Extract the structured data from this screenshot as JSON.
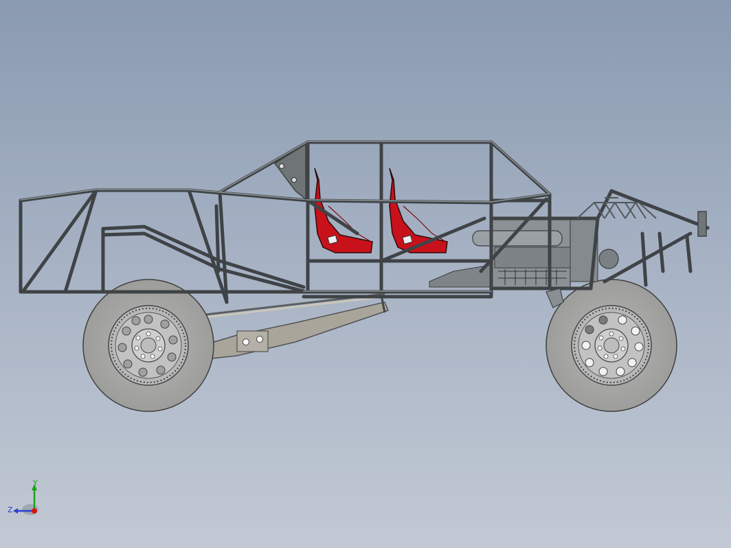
{
  "viewport": {
    "background_top": "#8a9ab0",
    "background_bottom": "#c2c9d4"
  },
  "model": {
    "frame_color": "#3f4346",
    "frame_fill": "#6d7275",
    "seat_color": "#c8111b",
    "tire_color": "#a9a9a7",
    "wheel_color": "#bdbdbd",
    "engine_color": "#8e9396"
  },
  "triad": {
    "y_label": "Y",
    "z_label": "Z",
    "y_color": "#1aa31a",
    "z_color": "#2a3fd0",
    "x_color": "#d01818"
  }
}
